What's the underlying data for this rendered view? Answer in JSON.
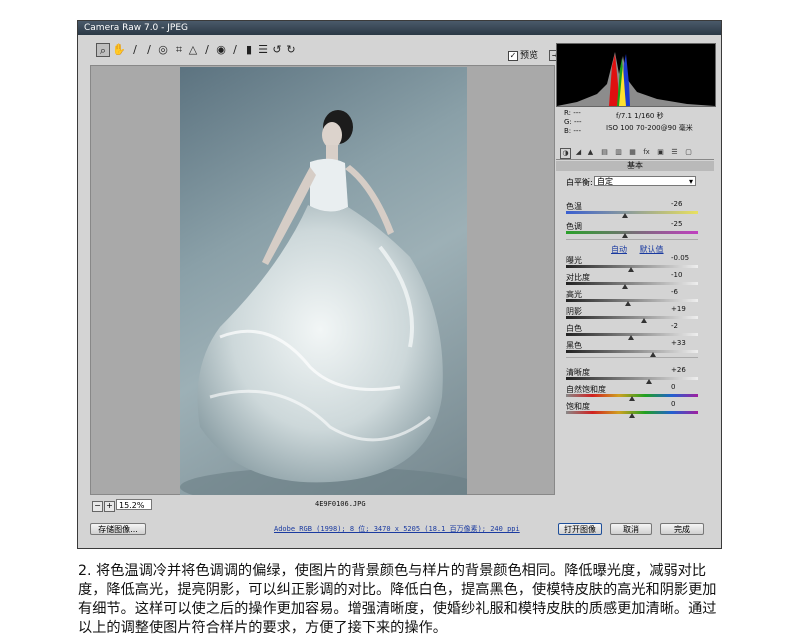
{
  "window": {
    "title": "Camera Raw 7.0 - JPEG"
  },
  "toolbar": {
    "tools": [
      "zoom-icon",
      "hand-icon",
      "white-balance-icon",
      "color-sampler-icon",
      "target-adjust-icon",
      "crop-icon",
      "straighten-icon",
      "spot-removal-icon",
      "red-eye-icon",
      "adjustment-brush-icon",
      "graduated-filter-icon",
      "preferences-icon",
      "rotate-ccw-icon",
      "rotate-cw-icon"
    ],
    "preview_label": "预览"
  },
  "canvas": {
    "zoom": "15.2%",
    "filename": "4E9F0106.JPG"
  },
  "bottom": {
    "save_label": "存储图像...",
    "workflow": "Adobe RGB (1998); 8 位; 3470 x 5205 (18.1 百万像素); 240 ppi",
    "open_label": "打开图像",
    "cancel_label": "取消",
    "done_label": "完成"
  },
  "info": {
    "r": "R: ---",
    "g": "G: ---",
    "b": "B: ---",
    "aperture_shutter": "f/7.1  1/160 秒",
    "iso_lens": "ISO 100  70-200@90 毫米"
  },
  "panel": {
    "header": "基本",
    "wb_label": "白平衡:",
    "wb_value": "自定",
    "auto": "自动",
    "default": "默认值",
    "sliders_top": [
      {
        "label": "色温",
        "value": "-26",
        "pos": 0.45
      },
      {
        "label": "色调",
        "value": "-25",
        "pos": 0.45
      }
    ],
    "sliders_tone": [
      {
        "label": "曝光",
        "value": "-0.05",
        "pos": 0.49
      },
      {
        "label": "对比度",
        "value": "-10",
        "pos": 0.45
      },
      {
        "label": "高光",
        "value": "-6",
        "pos": 0.47
      },
      {
        "label": "阴影",
        "value": "+19",
        "pos": 0.59
      },
      {
        "label": "白色",
        "value": "-2",
        "pos": 0.49
      },
      {
        "label": "黑色",
        "value": "+33",
        "pos": 0.66
      }
    ],
    "sliders_presence": [
      {
        "label": "清晰度",
        "value": "+26",
        "pos": 0.63
      },
      {
        "label": "自然饱和度",
        "value": "0",
        "pos": 0.5
      },
      {
        "label": "饱和度",
        "value": "0",
        "pos": 0.5
      }
    ]
  },
  "caption": "2. 将色温调冷并将色调调的偏绿，使图片的背景颜色与样片的背景颜色相同。降低曝光度，减弱对比度，降低高光，提亮阴影，可以纠正影调的对比。降低白色，提高黑色，使模特皮肤的高光和阴影更加有细节。这样可以使之后的操作更加容易。增强清晰度，使婚纱礼服和模特皮肤的质感更加清晰。通过以上的调整使图片符合样片的要求，方便了接下来的操作。"
}
